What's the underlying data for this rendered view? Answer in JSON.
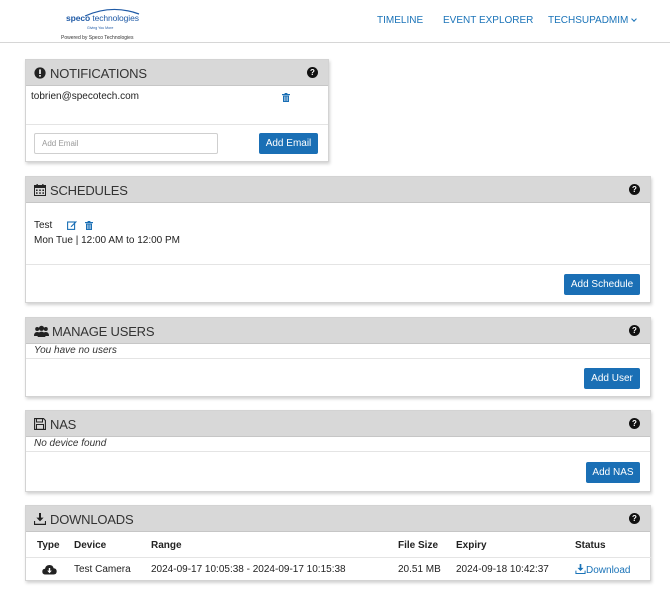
{
  "header": {
    "logo": {
      "brand_bold": "speco",
      "brand_light": "technologies",
      "tagline": "Giving You More",
      "powered_by": "Powered by Speco Technologies"
    },
    "nav": {
      "timeline": "TIMELINE",
      "event_explorer": "EVENT EXPLORER",
      "user_menu": "TECHSUPADMIM"
    }
  },
  "notifications": {
    "title": "NOTIFICATIONS",
    "icon": "exclamation-circle-icon",
    "emails": [
      "tobrien@specotech.com"
    ],
    "add_email_placeholder": "Add Email",
    "add_email_button": "Add Email"
  },
  "schedules": {
    "title": "SCHEDULES",
    "icon": "calendar-icon",
    "items": [
      {
        "name": "Test",
        "detail": "Mon Tue | 12:00 AM to 12:00 PM"
      }
    ],
    "add_button": "Add Schedule"
  },
  "manage_users": {
    "title": "MANAGE USERS",
    "icon": "users-icon",
    "empty_text": "You have no users",
    "add_button": "Add User"
  },
  "nas": {
    "title": "NAS",
    "icon": "floppy-disk-icon",
    "empty_text": "No device found",
    "add_button": "Add NAS"
  },
  "downloads": {
    "title": "DOWNLOADS",
    "icon": "download-icon",
    "columns": [
      "Type",
      "Device",
      "Range",
      "File Size",
      "Expiry",
      "Status"
    ],
    "rows": [
      {
        "type_icon": "cloud-download-icon",
        "device": "Test Camera",
        "range": "2024-09-17 10:05:38 - 2024-09-17 10:15:38",
        "file_size": "20.51 MB",
        "expiry": "2024-09-18 10:42:37",
        "status": "Download"
      }
    ]
  },
  "help_symbol": "?",
  "colors": {
    "accent": "#1a6fb5",
    "link": "#1a73b8",
    "panel_header": "#d8d8d8"
  }
}
